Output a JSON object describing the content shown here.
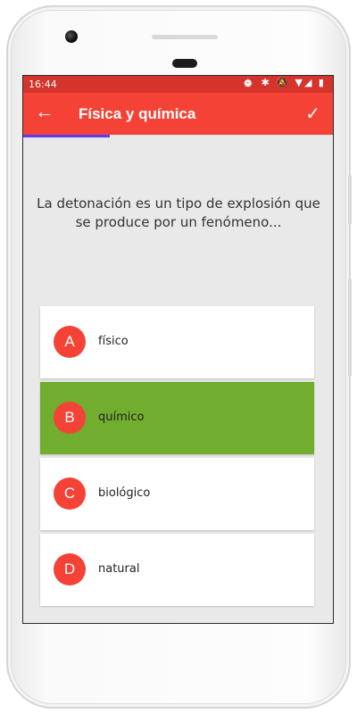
{
  "status_bar": {
    "time": "16:44",
    "icons": "⏰ ✱ 🔕 ▼◢ ▮"
  },
  "app_bar": {
    "back_icon": "←",
    "title": "Física y química",
    "confirm_icon": "✓"
  },
  "progress": {
    "fraction": 0.28,
    "color": "#5c3df2"
  },
  "question": {
    "text": "La detonación es un tipo de explosión que se produce por un fenómeno..."
  },
  "answers": [
    {
      "letter": "A",
      "text": "físico",
      "selected": false
    },
    {
      "letter": "B",
      "text": "químico",
      "selected": true
    },
    {
      "letter": "C",
      "text": "biológico",
      "selected": false
    },
    {
      "letter": "D",
      "text": "natural",
      "selected": false
    }
  ],
  "colors": {
    "accent": "#f44336",
    "status_bar": "#d4342b",
    "selected_answer": "#71ad2f",
    "background": "#e9e9e9"
  }
}
